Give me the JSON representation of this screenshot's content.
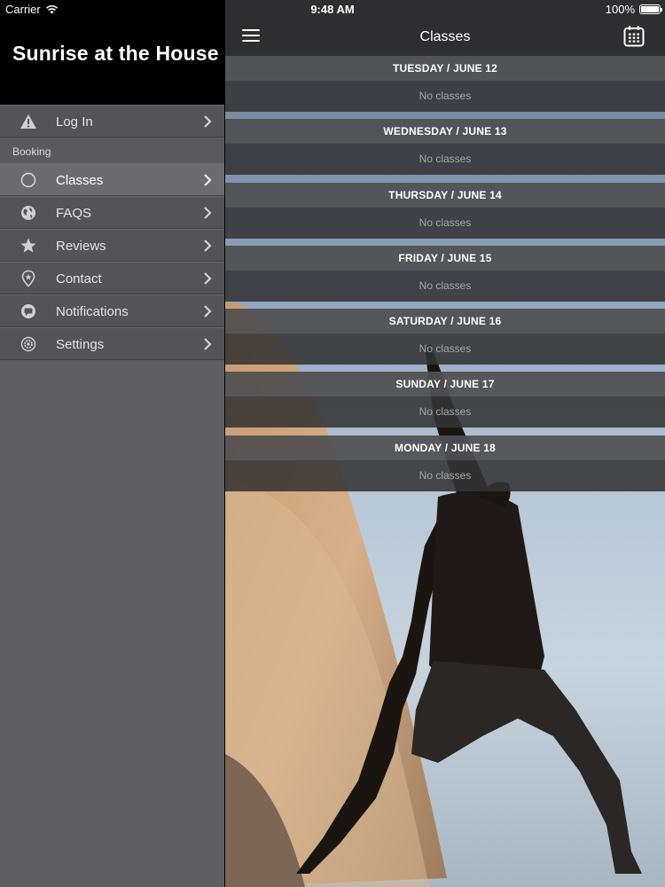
{
  "status_bar": {
    "carrier": "Carrier",
    "time": "9:48 AM",
    "battery": "100%"
  },
  "sidebar": {
    "app_title": "Sunrise at the House",
    "login": {
      "label": "Log In",
      "icon": "warning-icon"
    },
    "section_label": "Booking",
    "items": [
      {
        "label": "Classes",
        "icon": "circle-icon",
        "active": true
      },
      {
        "label": "FAQS",
        "icon": "globe-icon",
        "active": false
      },
      {
        "label": "Reviews",
        "icon": "star-icon",
        "active": false
      },
      {
        "label": "Contact",
        "icon": "location-pin-icon",
        "active": false
      },
      {
        "label": "Notifications",
        "icon": "chat-bubble-icon",
        "active": false
      },
      {
        "label": "Settings",
        "icon": "gear-icon",
        "active": false
      }
    ]
  },
  "main": {
    "title": "Classes",
    "days": [
      {
        "header": "TUESDAY / JUNE 12",
        "status": "No classes"
      },
      {
        "header": "WEDNESDAY / JUNE 13",
        "status": "No classes"
      },
      {
        "header": "THURSDAY / JUNE 14",
        "status": "No classes"
      },
      {
        "header": "FRIDAY / JUNE 15",
        "status": "No classes"
      },
      {
        "header": "SATURDAY / JUNE 16",
        "status": "No classes"
      },
      {
        "header": "SUNDAY / JUNE 17",
        "status": "No classes"
      },
      {
        "header": "MONDAY / JUNE 18",
        "status": "No classes"
      }
    ]
  },
  "colors": {
    "sidebar_bg": "#5f5f62",
    "menu_item_bg": "#545457",
    "menu_item_active_bg": "#6c6c6f",
    "topbar_bg": "#2e2e30",
    "day_header_bg": "#505052",
    "day_empty_bg": "#343436"
  }
}
